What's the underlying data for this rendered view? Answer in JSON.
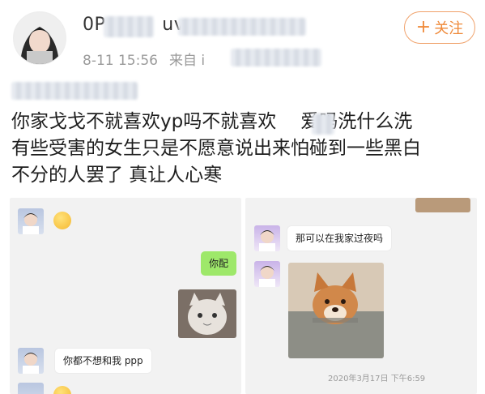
{
  "post": {
    "username_visible": "0P",
    "username_tail": "uv",
    "date": "8-11 15:56",
    "source_prefix": "来自 i",
    "follow_label": "关注",
    "follow_plus": "+",
    "text_lines": [
      "你家戈戈不就喜欢yp吗不就喜欢",
      "爱吗洗什么洗",
      "有些受害的女生只是不愿意说出来怕碰到一些黑白",
      "不分的人罢了 真让人心寒"
    ]
  },
  "chat_left": {
    "bubble_reply": "你配",
    "bubble_msg": "你都不想和我 ppp"
  },
  "chat_right": {
    "bubble_msg": "那可以在我家过夜吗",
    "timestamp": "2020年3月17日 下午6:59"
  },
  "colors": {
    "accent": "#ef8a3a",
    "wechat_green": "#9ee86a"
  }
}
